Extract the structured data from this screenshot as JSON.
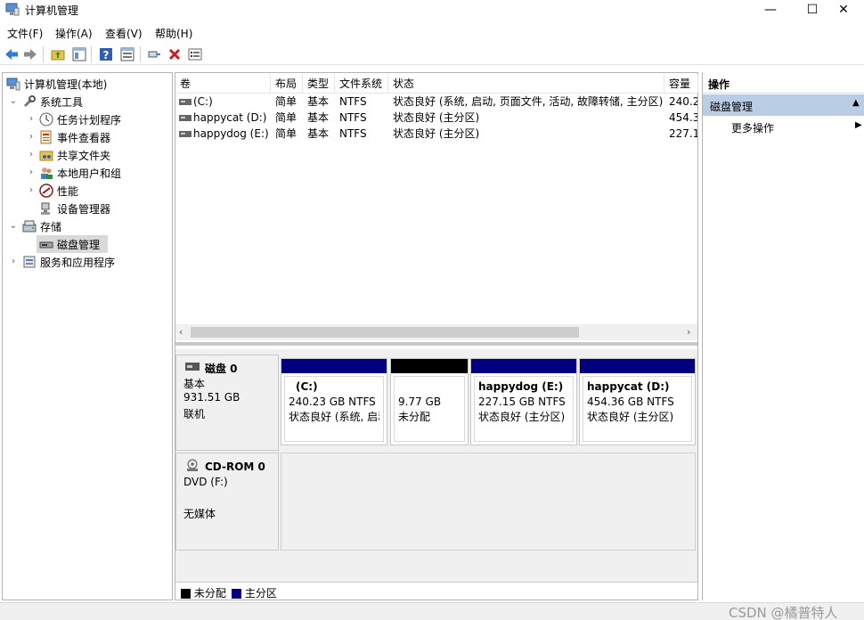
{
  "window": {
    "title": "计算机管理",
    "minimize": "—",
    "maximize": "☐",
    "close": "✕"
  },
  "menu": [
    "文件(F)",
    "操作(A)",
    "查看(V)",
    "帮助(H)"
  ],
  "tree": {
    "root": "计算机管理(本地)",
    "system_tools": "系统工具",
    "task_scheduler": "任务计划程序",
    "event_viewer": "事件查看器",
    "shared_folders": "共享文件夹",
    "local_users": "本地用户和组",
    "performance": "性能",
    "device_manager": "设备管理器",
    "storage": "存储",
    "disk_management": "磁盘管理",
    "services_apps": "服务和应用程序"
  },
  "volumes": {
    "headers": [
      "卷",
      "布局",
      "类型",
      "文件系统",
      "状态",
      "容量"
    ],
    "rows": [
      {
        "name": "(C:)",
        "layout": "简单",
        "type": "基本",
        "fs": "NTFS",
        "status": "状态良好 (系统, 启动, 页面文件, 活动, 故障转储, 主分区)",
        "capacity": "240.2"
      },
      {
        "name": "happycat (D:)",
        "layout": "简单",
        "type": "基本",
        "fs": "NTFS",
        "status": "状态良好 (主分区)",
        "capacity": "454.3"
      },
      {
        "name": "happydog (E:)",
        "layout": "简单",
        "type": "基本",
        "fs": "NTFS",
        "status": "状态良好 (主分区)",
        "capacity": "227.1"
      }
    ]
  },
  "disk0": {
    "name": "磁盘 0",
    "type": "基本",
    "size": "931.51 GB",
    "state": "联机",
    "partitions": [
      {
        "title": "(C:)",
        "size": "240.23 GB NTFS",
        "status": "状态良好 (系统, 启动",
        "color": "#000080"
      },
      {
        "title": "",
        "size": "9.77 GB",
        "status": "未分配",
        "color": "#000000"
      },
      {
        "title": "happydog  (E:)",
        "size": "227.15 GB NTFS",
        "status": "状态良好 (主分区)",
        "color": "#000080"
      },
      {
        "title": "happycat  (D:)",
        "size": "454.36 GB NTFS",
        "status": "状态良好 (主分区)",
        "color": "#000080"
      }
    ]
  },
  "cdrom": {
    "name": "CD-ROM 0",
    "drive": "DVD (F:)",
    "media": "无媒体"
  },
  "legend": {
    "unallocated": "未分配",
    "primary": "主分区",
    "unallocated_color": "#000000",
    "primary_color": "#000080"
  },
  "actions": {
    "header": "操作",
    "section": "磁盘管理",
    "more": "更多操作"
  },
  "watermark": "CSDN @橘普特人"
}
